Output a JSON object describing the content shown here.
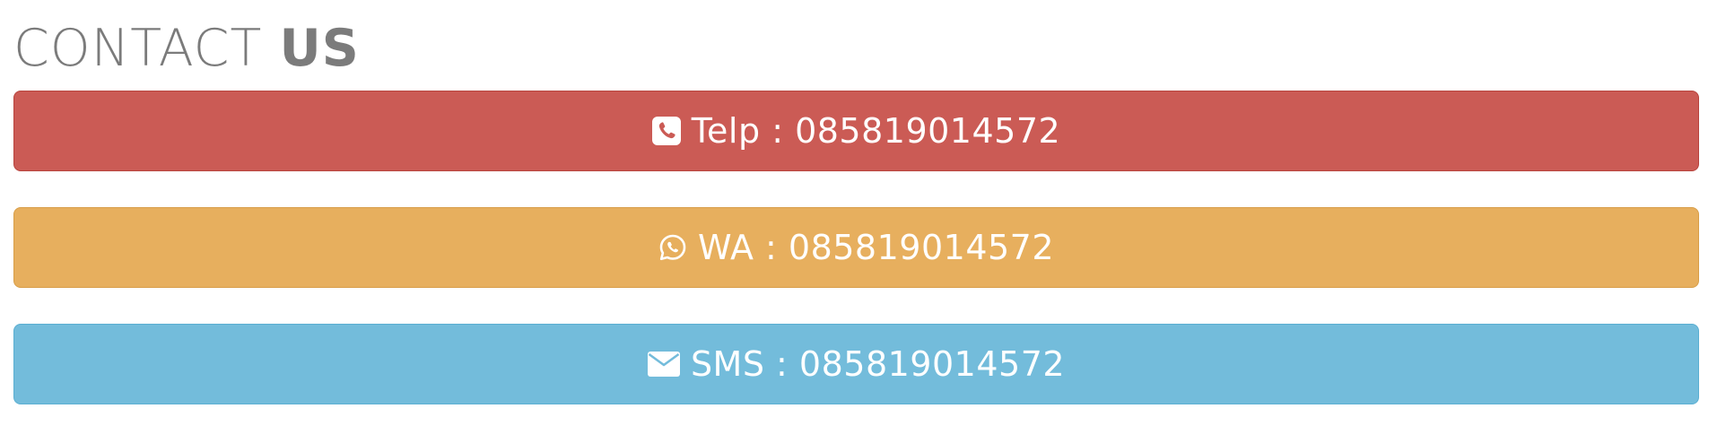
{
  "heading": {
    "light": "CONTACT ",
    "bold": "US"
  },
  "contacts": [
    {
      "icon": "phone-square-icon",
      "label": "Telp : 085819014572",
      "color": "#cb5b55"
    },
    {
      "icon": "whatsapp-icon",
      "label": "WA : 085819014572",
      "color": "#e7af5e"
    },
    {
      "icon": "envelope-icon",
      "label": "SMS : 085819014572",
      "color": "#73bcdb"
    }
  ]
}
